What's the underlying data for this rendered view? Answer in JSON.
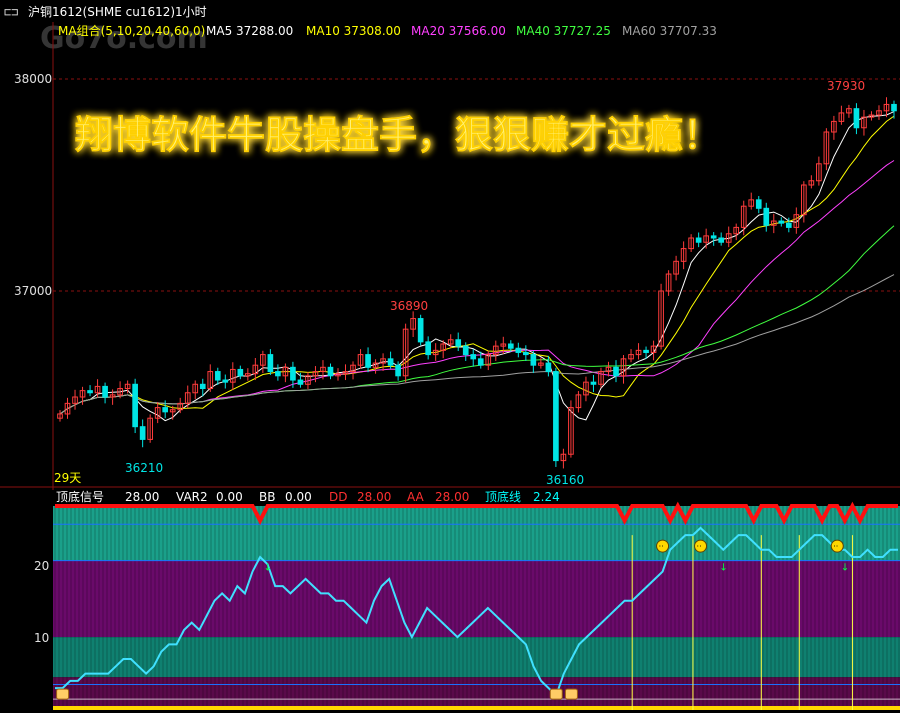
{
  "window": {
    "title": "沪铜1612(SHME cu1612)1小时",
    "watermark": "Go7o.com"
  },
  "ma_legend": {
    "group": "MA组合(5,10,20,40,60,0)",
    "items": [
      {
        "label": "MA5 37288.00",
        "color": "#ffffff"
      },
      {
        "label": "MA10 37308.00",
        "color": "#ffff00"
      },
      {
        "label": "MA20 37566.00",
        "color": "#ff40ff"
      },
      {
        "label": "MA40 37727.25",
        "color": "#40ff40"
      },
      {
        "label": "MA60 37707.33",
        "color": "#a0a0a0"
      }
    ]
  },
  "banner": "翔博软件牛股操盘手，狠狠赚才过瘾！",
  "axis": {
    "price_ticks": [
      "38000",
      "37000"
    ],
    "ind_ticks": [
      "20",
      "10"
    ]
  },
  "annotations": {
    "high1": "36890",
    "high2": "37930",
    "low1": "36210",
    "low2": "36160",
    "days": "29天"
  },
  "indicator_header": {
    "name": "顶底信号",
    "fields": [
      {
        "label": "",
        "value": "28.00",
        "color": "#ffffff"
      },
      {
        "label": "VAR2",
        "value": "0.00",
        "color": "#ffffff"
      },
      {
        "label": "BB",
        "value": "0.00",
        "color": "#ffffff"
      },
      {
        "label": "DD",
        "value": "28.00",
        "color": "#ff3030"
      },
      {
        "label": "AA",
        "value": "28.00",
        "color": "#ff3030"
      },
      {
        "label": "顶底线",
        "value": "2.24",
        "color": "#00ffff"
      }
    ]
  },
  "colors": {
    "up": "#ff3c3c",
    "down": "#00e5e5",
    "bg": "#000000",
    "grid": "#8a1010"
  },
  "chart_data": [
    {
      "type": "candlestick",
      "symbol": "cu1612",
      "period": "1小时",
      "ylim": [
        36100,
        38050
      ],
      "close": [
        36420,
        36470,
        36500,
        36530,
        36520,
        36550,
        36500,
        36510,
        36540,
        36560,
        36360,
        36300,
        36400,
        36450,
        36430,
        36440,
        36470,
        36520,
        36560,
        36540,
        36620,
        36580,
        36570,
        36630,
        36600,
        36610,
        36650,
        36700,
        36620,
        36600,
        36640,
        36580,
        36560,
        36600,
        36620,
        36640,
        36600,
        36610,
        36620,
        36650,
        36700,
        36640,
        36660,
        36680,
        36650,
        36600,
        36820,
        36870,
        36760,
        36700,
        36720,
        36750,
        36770,
        36740,
        36700,
        36680,
        36650,
        36700,
        36740,
        36750,
        36730,
        36710,
        36700,
        36650,
        36660,
        36620,
        36200,
        36230,
        36450,
        36510,
        36570,
        36560,
        36620,
        36640,
        36600,
        36680,
        36700,
        36720,
        36710,
        36740,
        37000,
        37080,
        37140,
        37200,
        37250,
        37230,
        37260,
        37250,
        37230,
        37270,
        37300,
        37400,
        37430,
        37390,
        37310,
        37330,
        37320,
        37300,
        37360,
        37500,
        37520,
        37600,
        37750,
        37800,
        37840,
        37860,
        37770,
        37820,
        37830,
        37850,
        37880,
        37850
      ]
    },
    {
      "type": "line",
      "title": "顶底信号",
      "ylim": [
        0,
        28
      ],
      "zones": [
        {
          "name": "top",
          "range": [
            20.5,
            28
          ],
          "color": "#1aa08a"
        },
        {
          "name": "upper-mid",
          "range": [
            10,
            20.5
          ],
          "color": "#6a0a6a"
        },
        {
          "name": "lower-mid",
          "range": [
            4.5,
            10
          ],
          "color": "#0f8070"
        },
        {
          "name": "bottom",
          "range": [
            0,
            4.5
          ],
          "color": "#5a0a4a"
        }
      ],
      "series": [
        {
          "name": "顶底线",
          "values": [
            3,
            3,
            4,
            4,
            5,
            5,
            5,
            5,
            6,
            7,
            7,
            6,
            5,
            6,
            8,
            9,
            9,
            11,
            12,
            11,
            13,
            15,
            16,
            15,
            17,
            16,
            19,
            21,
            20,
            17,
            17,
            16,
            17,
            18,
            17,
            16,
            16,
            15,
            15,
            14,
            13,
            12,
            15,
            17,
            18,
            15,
            12,
            10,
            12,
            14,
            13,
            12,
            11,
            10,
            11,
            12,
            13,
            14,
            13,
            12,
            11,
            10,
            9,
            6,
            4,
            3,
            2,
            5,
            7,
            9,
            10,
            11,
            12,
            13,
            14,
            15,
            15,
            16,
            17,
            18,
            19,
            22,
            23,
            24,
            24,
            25,
            24,
            23,
            22,
            23,
            24,
            24,
            23,
            22,
            22,
            21,
            21,
            21,
            22,
            23,
            24,
            24,
            23,
            22,
            22,
            21,
            21,
            22,
            21,
            21,
            22,
            22
          ]
        }
      ]
    }
  ]
}
